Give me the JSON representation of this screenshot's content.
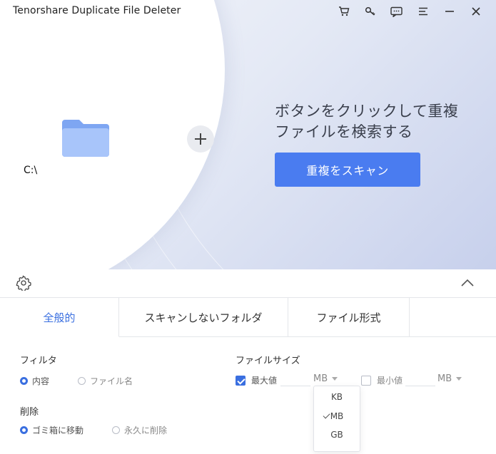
{
  "app": {
    "title": "Tenorshare Duplicate File Deleter"
  },
  "window_controls": [
    {
      "icon": "cart-icon"
    },
    {
      "icon": "key-icon"
    },
    {
      "icon": "feedback-icon"
    },
    {
      "icon": "menu-icon"
    },
    {
      "icon": "minimize-icon"
    },
    {
      "icon": "close-icon"
    }
  ],
  "hero": {
    "drive_label": "C:\\",
    "headline_line1": "ボタンをクリックして重複",
    "headline_line2": "ファイルを検索する",
    "scan_button": "重複をスキャン"
  },
  "tabs": [
    {
      "label": "全般的",
      "active": true
    },
    {
      "label": "スキャンしないフォルダ",
      "active": false
    },
    {
      "label": "ファイル形式",
      "active": false
    }
  ],
  "filter": {
    "label": "フィルタ",
    "options": [
      {
        "label": "内容",
        "selected": true
      },
      {
        "label": "ファイル名",
        "selected": false
      }
    ]
  },
  "delete": {
    "label": "削除",
    "options": [
      {
        "label": "ゴミ箱に移動",
        "selected": true
      },
      {
        "label": "永久に削除",
        "selected": false
      }
    ]
  },
  "file_size": {
    "label": "ファイルサイズ",
    "max": {
      "label": "最大値",
      "checked": true,
      "value": "",
      "unit": "MB"
    },
    "min": {
      "label": "最小値",
      "checked": false,
      "value": "",
      "unit": "MB"
    },
    "unit_options": [
      "KB",
      "MB",
      "GB"
    ],
    "unit_selected": "MB"
  },
  "colors": {
    "accent": "#4a7cf0",
    "active_tab": "#3a6fe0",
    "folder": "#8fb4f5"
  }
}
